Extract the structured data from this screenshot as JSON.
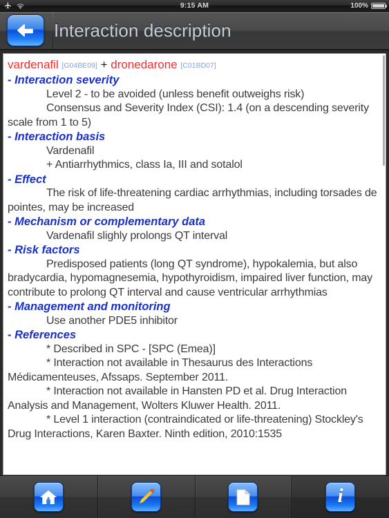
{
  "status_bar": {
    "airplane_icon": "airplane-mode-icon",
    "wifi_icon": "wifi-icon",
    "time": "9:15 AM",
    "battery_percent": "100%",
    "battery_icon": "battery-full-icon"
  },
  "nav_bar": {
    "back_icon": "back-arrow-icon",
    "title": "Interaction description"
  },
  "content": {
    "drug_a": "vardenafil",
    "drug_a_code": "[G04BE09]",
    "separator": "+",
    "drug_b": "dronedarone",
    "drug_b_code": "[C01BD07]",
    "sections": [
      {
        "heading": "- Interaction severity",
        "paragraphs": [
          "Level 2 - to be avoided (unless benefit outweighs risk)",
          "Consensus and Severity Index (CSI): 1.4 (on a descending severity scale from 1 to 5)"
        ]
      },
      {
        "heading": "- Interaction basis",
        "paragraphs": [
          "Vardenafil",
          "+ Antiarrhythmics, class Ia, III and sotalol"
        ]
      },
      {
        "heading": "- Effect",
        "paragraphs": [
          "The risk of life-threatening cardiac arrhythmias, including torsades de pointes, may be increased"
        ]
      },
      {
        "heading": "- Mechanism or complementary data",
        "paragraphs": [
          "Vardenafil slighly prolongs QT interval"
        ]
      },
      {
        "heading": "- Risk factors",
        "paragraphs": [
          "Predisposed patients (long QT syndrome), hypokalemia, but also bradycardia, hypomagnesemia, hypothyroidism, impaired liver function, may contribute to prolong QT interval and cause ventricular arrhythmias"
        ]
      },
      {
        "heading": "- Management and monitoring",
        "paragraphs": [
          "Use another PDE5 inhibitor"
        ]
      },
      {
        "heading": "- References",
        "paragraphs": [
          "* Described in SPC - [SPC (Emea)]",
          "* Interaction not available in Thesaurus des Interactions Médicamenteuses, Afssaps. September 2011.",
          "* Interaction not available in Hansten PD et al. Drug Interaction Analysis and Management, Wolters Kluwer Health. 2011.",
          "* Level 1 interaction (contraindicated or life-threatening) Stockley's Drug Interactions, Karen Baxter. Ninth edition, 2010:1535"
        ]
      }
    ]
  },
  "toolbar": {
    "buttons": [
      {
        "name": "home-button",
        "icon": "home-icon"
      },
      {
        "name": "edit-button",
        "icon": "pencil-icon"
      },
      {
        "name": "notes-button",
        "icon": "document-icon"
      },
      {
        "name": "info-button",
        "icon": "info-icon",
        "glyph": "i"
      }
    ]
  },
  "colors": {
    "drug_name": "#ef2f2f",
    "atc_code": "#7ea6e8",
    "section_heading": "#1a31c8",
    "body_text": "#3a3a3a",
    "nav_title": "#c4cfdb",
    "accent_blue": "#1b79f2"
  }
}
